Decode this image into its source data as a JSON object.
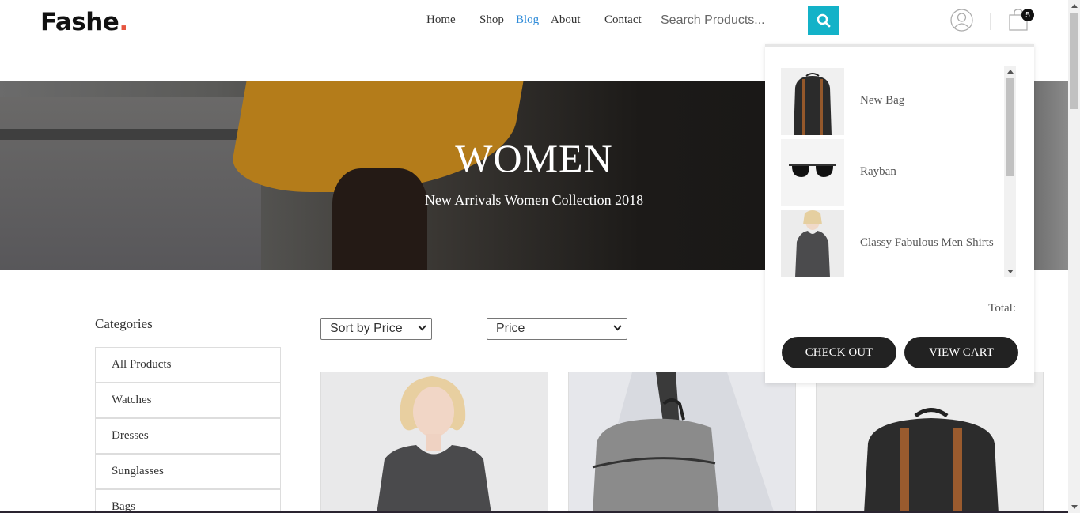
{
  "brand": {
    "name": "Fashe",
    "dot": ".",
    "accent": "#e65540"
  },
  "nav": {
    "items": [
      {
        "label": "Home",
        "active": false
      },
      {
        "label": "Shop",
        "active": false
      },
      {
        "label": "Blog",
        "active": true
      },
      {
        "label": "About",
        "active": false
      },
      {
        "label": "Contact",
        "active": false
      }
    ]
  },
  "search": {
    "placeholder": "Search Products...",
    "button_icon": "search-icon",
    "button_color": "#13b2c8"
  },
  "header_icons": {
    "user": "user-icon",
    "cart": "cart-icon",
    "cart_count": "5"
  },
  "hero": {
    "title": "WOMEN",
    "subtitle": "New Arrivals Women Collection 2018"
  },
  "sidebar": {
    "title": "Categories",
    "items": [
      "All Products",
      "Watches",
      "Dresses",
      "Sunglasses",
      "Bags"
    ]
  },
  "filters": {
    "sort": {
      "selected": "Sort by Price"
    },
    "price": {
      "selected": "Price"
    }
  },
  "products": [
    {
      "image": "woman-in-grey-tshirt"
    },
    {
      "image": "grey-knit-backpack"
    },
    {
      "image": "black-backpack-brown-straps"
    }
  ],
  "cart": {
    "items": [
      {
        "name": "New Bag",
        "image": "backpack"
      },
      {
        "name": "Rayban",
        "image": "sunglasses"
      },
      {
        "name": "Classy Fabulous Men Shirts",
        "image": "shirt"
      }
    ],
    "total_label": "Total:",
    "checkout_label": "CHECK OUT",
    "view_cart_label": "VIEW CART"
  }
}
